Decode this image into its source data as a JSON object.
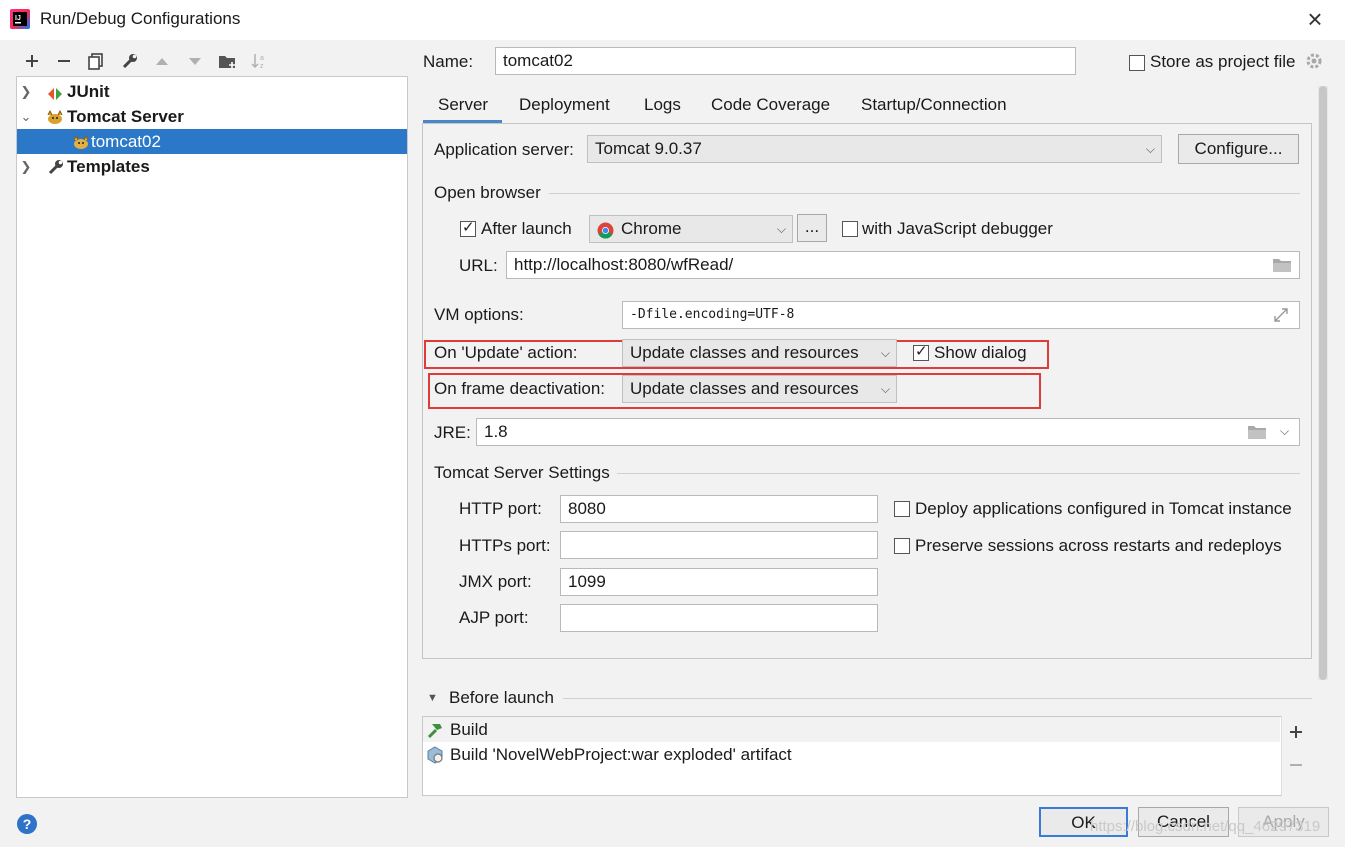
{
  "window": {
    "title": "Run/Debug Configurations",
    "close_glyph": "×"
  },
  "toolbar": [
    "add-icon",
    "remove-icon",
    "copy-icon",
    "wrench-icon",
    "move-up-icon",
    "move-down-icon",
    "folder-add-icon",
    "sort-icon"
  ],
  "tree": {
    "items": [
      {
        "label": "JUnit",
        "icon": "junit-icon",
        "expanded": false
      },
      {
        "label": "Tomcat Server",
        "icon": "tomcat-icon",
        "expanded": true
      },
      {
        "label": "tomcat02",
        "icon": "tomcat-icon",
        "selected": true
      },
      {
        "label": "Templates",
        "icon": "wrench-icon",
        "expanded": false
      }
    ]
  },
  "header": {
    "name_label": "Name:",
    "name_value": "tomcat02",
    "store_label": "Store as project file",
    "store_checked": false
  },
  "tabs": [
    "Server",
    "Deployment",
    "Logs",
    "Code Coverage",
    "Startup/Connection"
  ],
  "active_tab": "Server",
  "server": {
    "app_server_label": "Application server:",
    "app_server_value": "Tomcat 9.0.37",
    "configure_label": "Configure...",
    "open_browser_label": "Open browser",
    "after_launch_label": "After launch",
    "after_launch_checked": true,
    "browser_value": "Chrome",
    "browse_dots": "...",
    "js_debugger_label": "with JavaScript debugger",
    "js_debugger_checked": false,
    "url_label": "URL:",
    "url_value": "http://localhost:8080/wfRead/",
    "vm_options_label": "VM options:",
    "vm_options_value": "-Dfile.encoding=UTF-8",
    "on_update_label": "On 'Update' action:",
    "on_update_value": "Update classes and resources",
    "show_dialog_label": "Show dialog",
    "show_dialog_checked": true,
    "on_frame_label": "On frame deactivation:",
    "on_frame_value": "Update classes and resources",
    "jre_label": "JRE:",
    "jre_value": "1.8",
    "tomcat_settings_label": "Tomcat Server Settings",
    "http_port_label": "HTTP port:",
    "http_port_value": "8080",
    "https_port_label": "HTTPs port:",
    "https_port_value": "",
    "jmx_port_label": "JMX port:",
    "jmx_port_value": "1099",
    "ajp_port_label": "AJP port:",
    "ajp_port_value": "",
    "deploy_apps_label": "Deploy applications configured in Tomcat instance",
    "deploy_apps_checked": false,
    "preserve_sessions_label": "Preserve sessions across restarts and redeploys",
    "preserve_sessions_checked": false
  },
  "before_launch": {
    "title": "Before launch",
    "items": [
      {
        "label": "Build",
        "icon": "hammer-icon"
      },
      {
        "label": "Build 'NovelWebProject:war exploded' artifact",
        "icon": "artifact-icon"
      }
    ]
  },
  "footer": {
    "ok_label": "OK",
    "cancel_label": "Cancel",
    "apply_label": "Apply",
    "help_glyph": "?"
  },
  "watermark": "https://blog.csdn.net/qq_46297319",
  "colors": {
    "selection": "#2c78c8",
    "highlight_box": "#e03b3b",
    "link_blue": "#2f73c9"
  }
}
